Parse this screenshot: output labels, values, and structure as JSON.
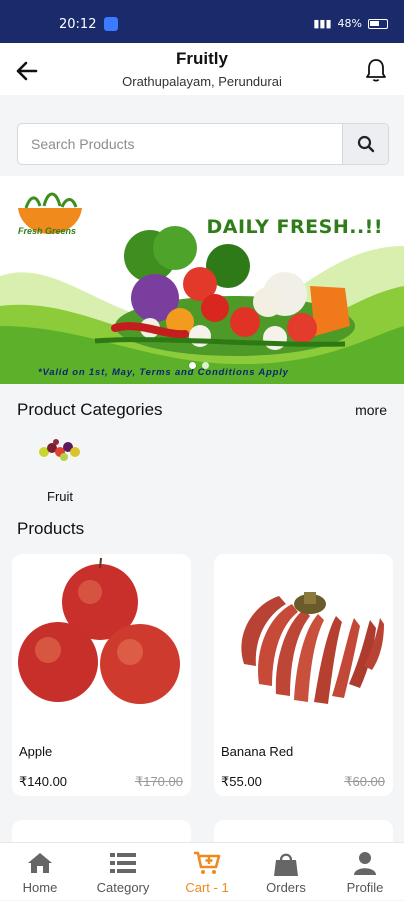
{
  "status_bar": {
    "time": "20:12",
    "battery": "48%"
  },
  "header": {
    "title": "Fruitly",
    "subtitle": "Orathupalayam, Perundurai"
  },
  "search": {
    "placeholder": "Search Products"
  },
  "banner": {
    "brand": "Fresh Greens",
    "headline": "DAILY FRESH..!!",
    "footer": "*Valid on 1st, May, Terms and Conditions Apply"
  },
  "categories": {
    "title": "Product Categories",
    "more_label": "more",
    "items": [
      {
        "label": "Fruit"
      }
    ]
  },
  "products": {
    "title": "Products",
    "items": [
      {
        "name": "Apple",
        "price": "₹140.00",
        "mrp": "₹170.00"
      },
      {
        "name": "Banana Red",
        "price": "₹55.00",
        "mrp": "₹60.00"
      }
    ]
  },
  "bottom_nav": [
    {
      "label": "Home",
      "icon": "home-icon"
    },
    {
      "label": "Category",
      "icon": "list-icon"
    },
    {
      "label": "Cart - 1",
      "icon": "cart-icon"
    },
    {
      "label": "Orders",
      "icon": "bag-icon"
    },
    {
      "label": "Profile",
      "icon": "user-icon"
    }
  ],
  "colors": {
    "accent": "#ef8a1f",
    "status_bar": "#1b2a6b",
    "banner_green": "#2f7d19"
  }
}
